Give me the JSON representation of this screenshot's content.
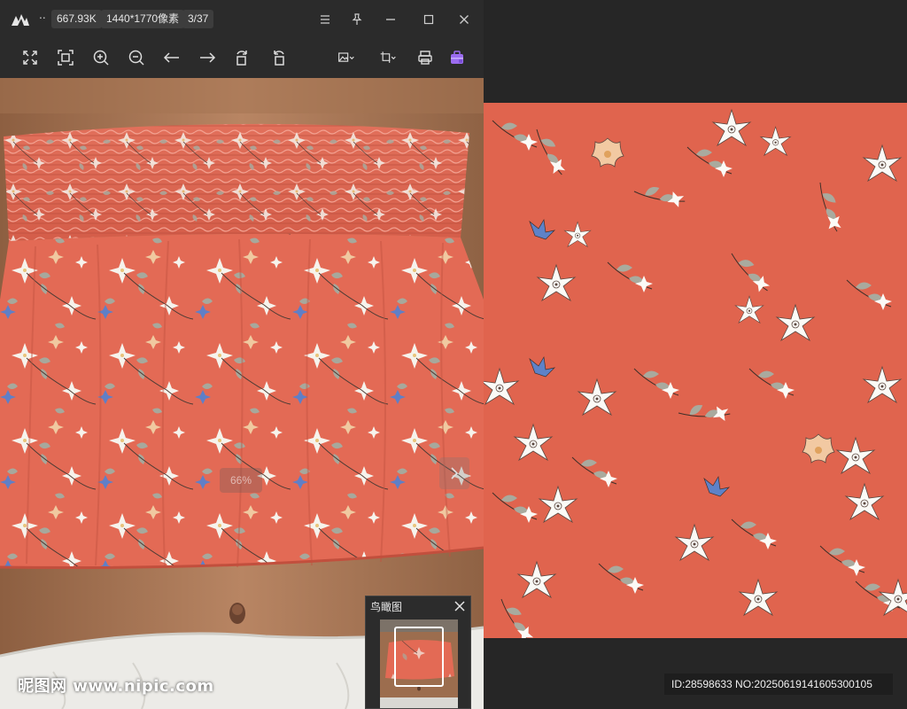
{
  "window": {
    "menu_dots": "..",
    "file_size": "667.93K",
    "dimensions": "1440*1770像素",
    "position": "3/37"
  },
  "toolbar": {
    "icons": [
      "fullscreen-icon",
      "fit-window-icon",
      "zoom-in-icon",
      "zoom-out-icon",
      "previous-icon",
      "next-icon",
      "rotate-left-icon",
      "rotate-right-icon",
      "image-edit-icon",
      "crop-icon",
      "print-icon",
      "toolbox-icon"
    ],
    "accent": "#9b6cf0"
  },
  "viewer": {
    "zoom_level": "66%",
    "next_arrow": "›"
  },
  "birdseye": {
    "title": "鸟瞰图"
  },
  "watermark": {
    "text": "昵图网 www.nipic.com"
  },
  "pattern_info": {
    "id_text": "ID:28598633 NO:20250619141605300105"
  },
  "colors": {
    "fabric": "#e36a55",
    "skin": "#b3805d",
    "background": "#262626"
  }
}
